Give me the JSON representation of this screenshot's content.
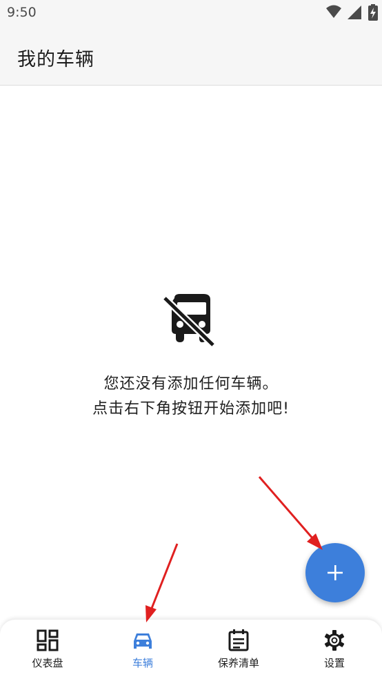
{
  "status_bar": {
    "time": "9:50"
  },
  "app_bar": {
    "title": "我的车辆"
  },
  "empty_state": {
    "line1": "您还没有添加任何车辆。",
    "line2": "点击右下角按钮开始添加吧!"
  },
  "fab": {
    "icon": "plus-icon"
  },
  "bottom_nav": {
    "active_index": 1,
    "items": [
      {
        "label": "仪表盘",
        "icon": "dashboard-icon"
      },
      {
        "label": "车辆",
        "icon": "car-icon"
      },
      {
        "label": "保养清单",
        "icon": "checklist-icon"
      },
      {
        "label": "设置",
        "icon": "gear-icon"
      }
    ]
  },
  "colors": {
    "accent": "#3d7fdb",
    "annotation": "#e02020"
  }
}
